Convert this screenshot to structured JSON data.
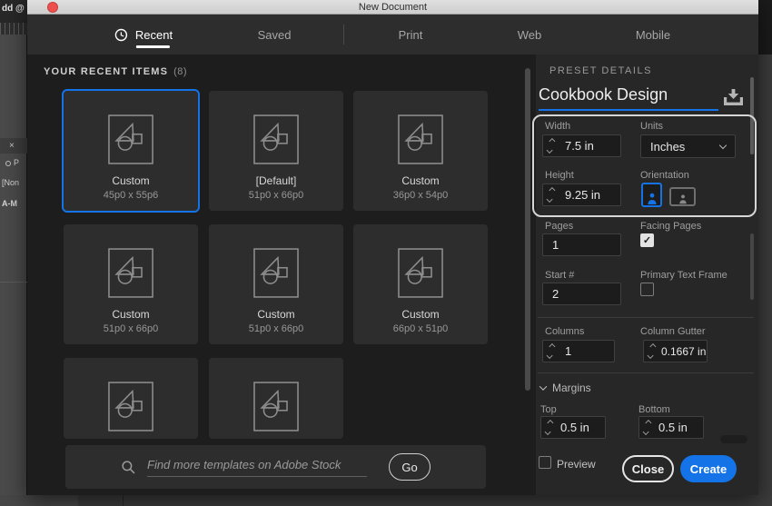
{
  "window": {
    "title": "New Document"
  },
  "chrome": {
    "app_title_fragment": "dd @",
    "panel_close": "×",
    "panel_items": [
      "P",
      "[Non",
      "A-M"
    ]
  },
  "tabs": [
    {
      "label": "Recent",
      "active": true
    },
    {
      "label": "Saved",
      "active": false
    },
    {
      "label": "Print",
      "active": false
    },
    {
      "label": "Web",
      "active": false
    },
    {
      "label": "Mobile",
      "active": false
    }
  ],
  "recent": {
    "header": "YOUR RECENT ITEMS",
    "count": "(8)",
    "items": [
      {
        "name": "Custom",
        "dims": "45p0 x 55p6",
        "selected": true
      },
      {
        "name": "[Default]",
        "dims": "51p0 x 66p0",
        "selected": false
      },
      {
        "name": "Custom",
        "dims": "36p0 x 54p0",
        "selected": false
      },
      {
        "name": "Custom",
        "dims": "51p0 x 66p0",
        "selected": false
      },
      {
        "name": "Custom",
        "dims": "51p0 x 66p0",
        "selected": false
      },
      {
        "name": "Custom",
        "dims": "66p0 x 51p0",
        "selected": false
      },
      {
        "name": "",
        "dims": "",
        "selected": false
      },
      {
        "name": "",
        "dims": "",
        "selected": false
      }
    ]
  },
  "search": {
    "placeholder": "Find more templates on Adobe Stock",
    "go_label": "Go"
  },
  "preset": {
    "header": "PRESET DETAILS",
    "name": "Cookbook Design",
    "width": {
      "label": "Width",
      "value": "7.5 in"
    },
    "units": {
      "label": "Units",
      "value": "Inches"
    },
    "height": {
      "label": "Height",
      "value": "9.25 in"
    },
    "orientation": {
      "label": "Orientation"
    },
    "pages": {
      "label": "Pages",
      "value": "1"
    },
    "facing_pages": {
      "label": "Facing Pages",
      "checked": true
    },
    "start": {
      "label": "Start #",
      "value": "2"
    },
    "primary_text_frame": {
      "label": "Primary Text Frame",
      "checked": false
    },
    "columns": {
      "label": "Columns",
      "value": "1"
    },
    "column_gutter": {
      "label": "Column Gutter",
      "value": "0.1667 in"
    },
    "margins": {
      "label": "Margins",
      "top": {
        "label": "Top",
        "value": "0.5 in"
      },
      "bottom": {
        "label": "Bottom",
        "value": "0.5 in"
      }
    },
    "preview_label": "Preview",
    "close_label": "Close",
    "create_label": "Create"
  },
  "colors": {
    "accent": "#1473e6",
    "titlebar_close": "#ee4f4c",
    "annotation_border": "#d6d6d6"
  }
}
